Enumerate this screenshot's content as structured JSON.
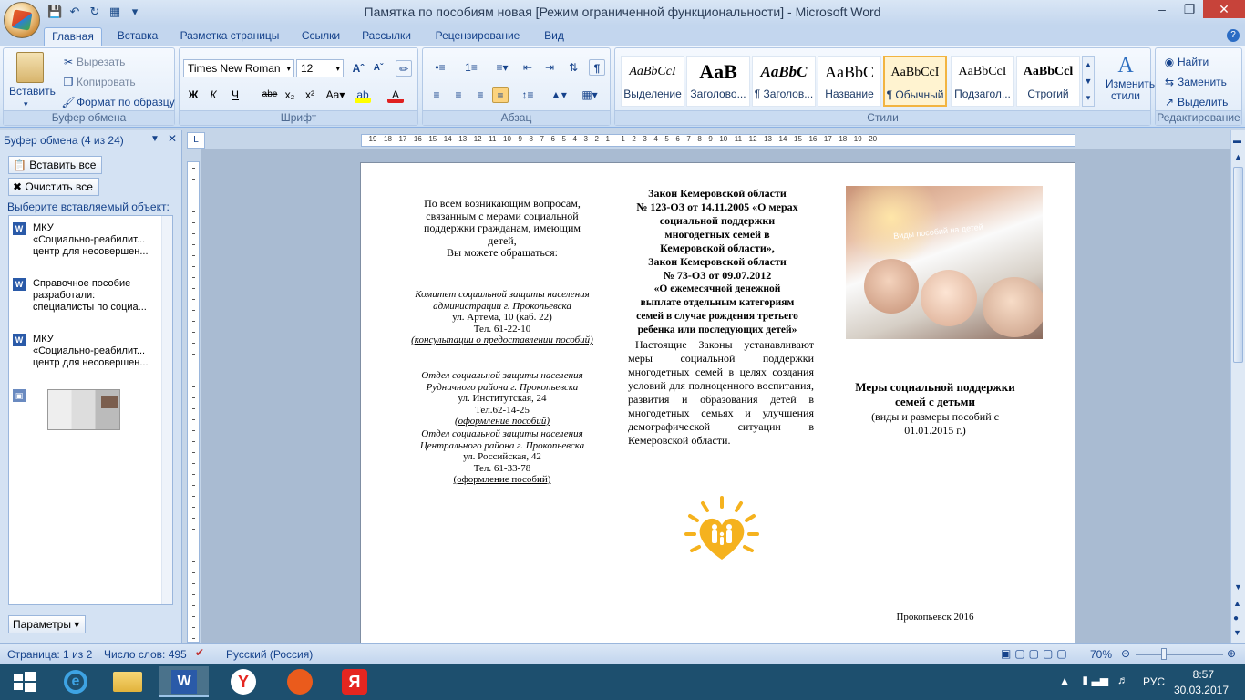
{
  "window": {
    "title": "Памятка по  пособиям новая [Режим ограниченной функциональности] - Microsoft Word"
  },
  "tabs": [
    "Главная",
    "Вставка",
    "Разметка страницы",
    "Ссылки",
    "Рассылки",
    "Рецензирование",
    "Вид"
  ],
  "ribbon": {
    "clipboard": {
      "paste": "Вставить",
      "cut": "Вырезать",
      "copy": "Копировать",
      "format_painter": "Формат по образцу",
      "label": "Буфер обмена"
    },
    "font": {
      "name": "Times New Roman",
      "size": "12",
      "label": "Шрифт"
    },
    "paragraph": {
      "label": "Абзац"
    },
    "styles": {
      "items": [
        {
          "preview": "AaBbCcI",
          "name": "Выделение"
        },
        {
          "preview": "AaB",
          "name": "Заголово..."
        },
        {
          "preview": "AaBbC",
          "name": "¶ Заголов..."
        },
        {
          "preview": "AaBbC",
          "name": "Название"
        },
        {
          "preview": "AaBbCcI",
          "name": "¶ Обычный"
        },
        {
          "preview": "AaBbCcI",
          "name": "Подзагол..."
        },
        {
          "preview": "AaBbCcl",
          "name": "Строгий"
        }
      ],
      "change": "Изменить стили",
      "label": "Стили"
    },
    "editing": {
      "find": "Найти",
      "replace": "Заменить",
      "select": "Выделить",
      "label": "Редактирование"
    }
  },
  "pane": {
    "title": "Буфер обмена (4 из 24)",
    "paste_all": "Вставить все",
    "clear_all": "Очистить все",
    "choose": "Выберите вставляемый объект:",
    "items": [
      {
        "lines": [
          "МКУ",
          "«Социально-реабилит...",
          "центр для несовершен..."
        ]
      },
      {
        "lines": [
          "Справочное пособие",
          "разработали:",
          "специалисты по социа..."
        ]
      },
      {
        "lines": [
          "МКУ",
          "«Социально-реабилит...",
          "центр для несовершен..."
        ]
      }
    ],
    "options": "Параметры"
  },
  "ruler": "· ·19· ·18· ·17· ·16· ·15· ·14· ·13· ·12· ·11· ·10· ·9· ·8· ·7· ·6· ·5· ·4· ·3· ·2· ·1· · ·1· ·2· ·3· ·4· ·5· ·6· ·7· ·8· ·9· ·10· ·11· ·12· ·13· ·14· ·15· ·16· ·17· ·18· ·19· ·20·",
  "doc": {
    "col1_intro": [
      "По всем возникающим вопросам,",
      "связанным с мерами социальной",
      "поддержки гражданам, имеющим",
      "детей,",
      "Вы можете обращаться:"
    ],
    "block1": {
      "org": [
        "Комитет социальной защиты населения",
        "администрации г. Прокопьевска"
      ],
      "addr": "ул. Артема, 10 (каб. 22)",
      "tel": "Тел. 61-22-10",
      "note": "(консультации о предоставлении пособий)"
    },
    "block2": {
      "org": [
        "Отдел социальной защиты населения",
        "Рудничного района г. Прокопьевска"
      ],
      "addr": "ул. Институтская, 24",
      "tel": "Тел.62-14-25",
      "note": "(оформление пособий)"
    },
    "block3": {
      "org": [
        "Отдел социальной защиты населения",
        "Центрального района г. Прокопьевска"
      ],
      "addr": "ул. Российская, 42",
      "tel": "Тел. 61-33-78",
      "note": "(оформление пособий)"
    },
    "col2_bold": [
      "Закон Кемеровской области",
      "№ 123-ОЗ от 14.11.2005 «О мерах",
      "социальной поддержки",
      "многодетных семей в",
      "Кемеровской области»,",
      "Закон Кемеровской области",
      "№ 73-ОЗ от 09.07.2012",
      "«О ежемесячной денежной",
      "выплате отдельным категориям",
      "семей в случае рождения третьего",
      "ребенка или последующих детей»"
    ],
    "col2_text": "Настоящие Законы устанавливают меры социальной поддержки многодетных семей в целях создания условий для полноценного воспитания, развития и образования детей в многодетных семьях и улучшения демографической ситуации в Кемеровской области.",
    "photo_caption": "Виды пособий на детей",
    "col3_title": [
      "Меры социальной поддержки",
      "семей с детьми"
    ],
    "col3_sub": [
      "(виды и размеры пособий с",
      "01.01.2015 г.)"
    ],
    "footer": "Прокопьевск 2016"
  },
  "status": {
    "page": "Страница: 1 из 2",
    "words": "Число слов: 495",
    "lang": "Русский (Россия)",
    "zoom": "70%"
  },
  "tray": {
    "lang": "РУС",
    "time": "8:57",
    "date": "30.03.2017"
  }
}
